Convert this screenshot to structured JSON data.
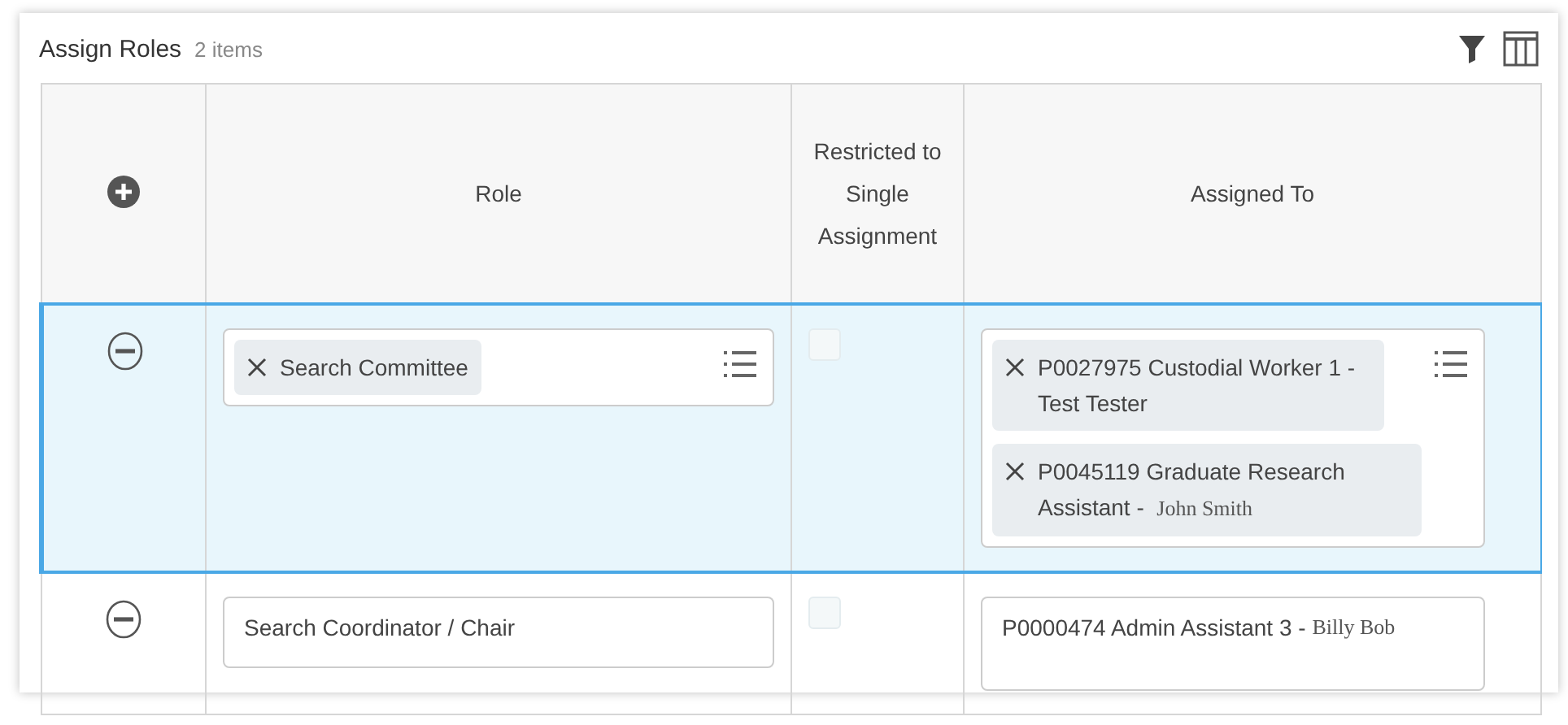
{
  "header": {
    "title": "Assign Roles",
    "count": "2 items"
  },
  "table": {
    "columns": [
      "Role",
      "Restricted to Single Assignment",
      "Assigned To"
    ],
    "rows": [
      {
        "selected": true,
        "role": {
          "kind": "chips",
          "chips": [
            "Search Committee"
          ]
        },
        "restricted": {
          "checked": false,
          "disabled": true
        },
        "assigned": {
          "kind": "chips",
          "items": [
            {
              "text": "P0027975 Custodial Worker 1 - Test Tester"
            },
            {
              "text": "P0045119 Graduate Research Assistant -",
              "person": "John Smith"
            }
          ]
        }
      },
      {
        "selected": false,
        "role": {
          "kind": "text",
          "value": "Search Coordinator / Chair"
        },
        "restricted": {
          "checked": false,
          "disabled": true
        },
        "assigned": {
          "kind": "text",
          "items": [
            {
              "text": "P0000474 Admin Assistant 3 -",
              "person": "Billy Bob"
            }
          ]
        }
      }
    ]
  }
}
